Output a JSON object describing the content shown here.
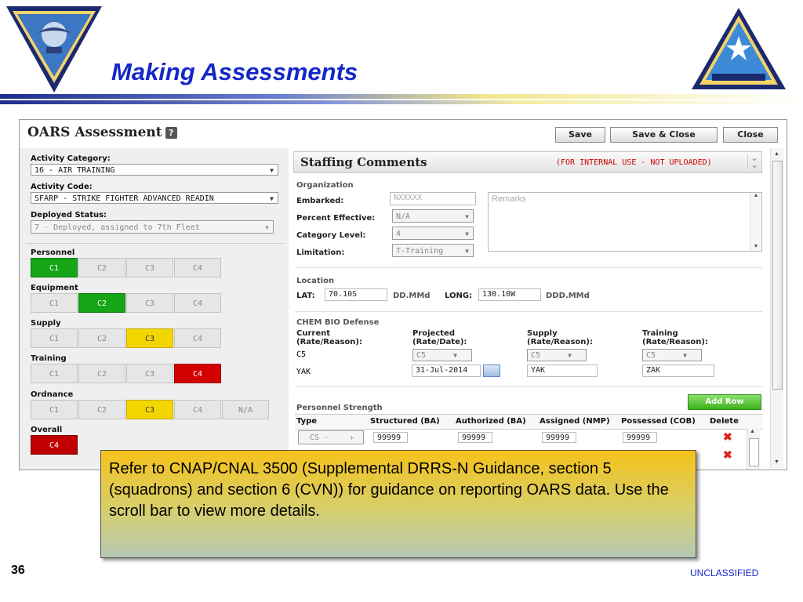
{
  "slide": {
    "title": "Making Assessments",
    "page_number": "36",
    "classification": "UNCLASSIFIED",
    "callout": "Refer to CNAP/CNAL 3500 (Supplemental DRRS-N Guidance, section 5 (squadrons) and section 6 (CVN)) for guidance on reporting OARS data.  Use the scroll bar to view more details."
  },
  "window": {
    "title": "OARS Assessment",
    "help_label": "?",
    "save_label": "Save",
    "save_close_label": "Save & Close",
    "close_label": "Close"
  },
  "left": {
    "activity_category_label": "Activity Category:",
    "activity_category_value": "16 - AIR TRAINING",
    "activity_code_label": "Activity Code:",
    "activity_code_value": "SFARP - STRIKE FIGHTER ADVANCED READIN",
    "deployed_status_label": "Deployed Status:",
    "deployed_status_value": "7 - Deployed, assigned to 7th Fleet",
    "personnel_label": "Personnel",
    "equipment_label": "Equipment",
    "supply_label": "Supply",
    "training_label": "Training",
    "ordnance_label": "Ordnance",
    "overall_label": "Overall",
    "c_levels": [
      "C1",
      "C2",
      "C3",
      "C4"
    ],
    "na_label": "N/A",
    "overall_value": "C4",
    "selected": {
      "personnel": "C1",
      "equipment": "C2",
      "supply": "C3",
      "training": "C4",
      "ordnance": "C3"
    },
    "colors": {
      "green": "#15a515",
      "yellow": "#f2d600",
      "red": "#d40000",
      "dark_red": "#c00000"
    }
  },
  "staffing": {
    "title": "Staffing Comments",
    "note": "(FOR INTERNAL USE - NOT UPLOADED)",
    "organization_label": "Organization",
    "embarked_label": "Embarked:",
    "embarked_placeholder": "NXXXXX",
    "remarks_placeholder": "Remarks",
    "percent_effective_label": "Percent Effective:",
    "percent_effective_value": "N/A",
    "category_level_label": "Category Level:",
    "category_level_value": "4",
    "limitation_label": "Limitation:",
    "limitation_value": "T-Training",
    "location_label": "Location",
    "lat_label": "LAT:",
    "lat_value": "70.10S",
    "lat_format": "DD.MMd",
    "long_label": "LONG:",
    "long_value": "130.10W",
    "long_format": "DDD.MMd",
    "chem_label": "CHEM BIO Defense",
    "current_label": "Current (Rate/Reason):",
    "current_rate": "C5",
    "current_reason": "YAK",
    "projected_label": "Projected (Rate/Date):",
    "projected_rate": "C5",
    "projected_date": "31-Jul-2014",
    "supply_label": "Supply (Rate/Reason):",
    "supply_rate": "C5",
    "supply_reason": "YAK",
    "training_label": "Training (Rate/Reason):",
    "training_rate": "C5",
    "training_reason": "ZAK",
    "personnel_strength_label": "Personnel Strength",
    "add_row_label": "Add Row",
    "table_headers": [
      "Type",
      "Structured (BA)",
      "Authorized (BA)",
      "Assigned (NMP)",
      "Possessed (COB)",
      "Delete"
    ],
    "row1": {
      "type": "CS -",
      "structured": "99999",
      "authorized": "99999",
      "assigned": "99999",
      "possessed": "99999"
    }
  }
}
